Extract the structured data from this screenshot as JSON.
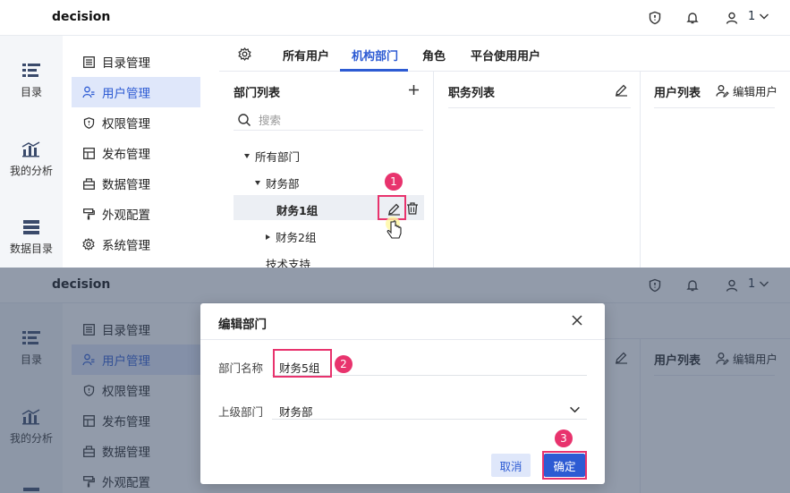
{
  "app": {
    "title": "decision",
    "user_number": "1"
  },
  "rail": [
    {
      "label": "目录",
      "icon": "catalog-icon"
    },
    {
      "label": "我的分析",
      "icon": "chart-icon"
    },
    {
      "label": "数据目录",
      "icon": "data-catalog-icon"
    }
  ],
  "menu": [
    {
      "label": "目录管理",
      "icon": "list-icon"
    },
    {
      "label": "用户管理",
      "icon": "user-manage-icon",
      "active": true
    },
    {
      "label": "权限管理",
      "icon": "shield-icon"
    },
    {
      "label": "发布管理",
      "icon": "publish-icon"
    },
    {
      "label": "数据管理",
      "icon": "database-icon"
    },
    {
      "label": "外观配置",
      "icon": "paint-roller-icon"
    },
    {
      "label": "系统管理",
      "icon": "gear-icon"
    }
  ],
  "tabs": [
    "所有用户",
    "机构部门",
    "角色",
    "平台使用用户"
  ],
  "active_tab": "机构部门",
  "dept": {
    "title": "部门列表",
    "search_placeholder": "搜索",
    "tree": {
      "root": "所有部门",
      "child": "财务部",
      "selected": "财务1组",
      "sibling": "财务2组",
      "other": "技术支持"
    }
  },
  "positions": {
    "title": "职务列表"
  },
  "users": {
    "title": "用户列表",
    "edit_label": "编辑用户"
  },
  "dialog": {
    "title": "编辑部门",
    "name_label": "部门名称",
    "name_value": "财务5组",
    "parent_label": "上级部门",
    "parent_value": "财务部",
    "cancel": "取消",
    "ok": "确定"
  },
  "steps": [
    "1",
    "2",
    "3"
  ],
  "colors": {
    "accent": "#2d5bd3",
    "highlight": "#e8336d",
    "selected_menu_bg": "#dfe7fa"
  }
}
